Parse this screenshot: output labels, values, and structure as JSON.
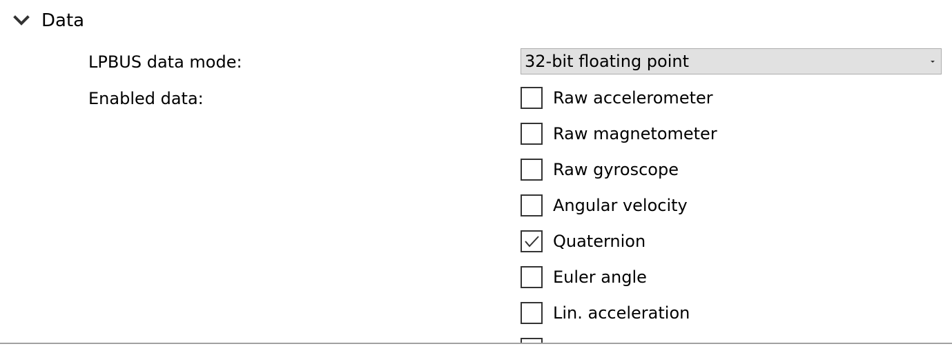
{
  "section": {
    "title": "Data",
    "expand_icon": "chevron-down-icon"
  },
  "fields": {
    "data_mode_label": "LPBUS data mode:",
    "enabled_data_label": "Enabled data:"
  },
  "data_mode_select": {
    "value": "32-bit floating point",
    "arrow_icon": "dropdown-arrow-icon"
  },
  "enabled_data": [
    {
      "label": "Raw accelerometer",
      "checked": false
    },
    {
      "label": "Raw magnetometer",
      "checked": false
    },
    {
      "label": "Raw gyroscope",
      "checked": false
    },
    {
      "label": "Angular velocity",
      "checked": false
    },
    {
      "label": "Quaternion",
      "checked": true
    },
    {
      "label": "Euler angle",
      "checked": false
    },
    {
      "label": "Lin. acceleration",
      "checked": false
    }
  ],
  "colors": {
    "select_background": "#e1e1e1",
    "checkbox_border": "#333333",
    "divider": "#a0a0a0"
  }
}
